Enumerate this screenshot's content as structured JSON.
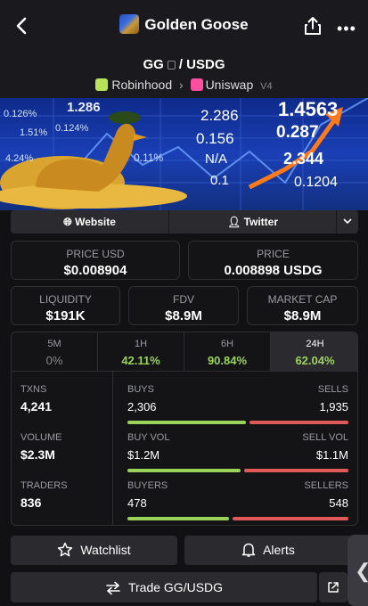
{
  "header": {
    "title": "Golden Goose",
    "back_icon": "chevron-left-icon",
    "share_icon": "share-icon",
    "more_icon": "more-icon"
  },
  "pair": {
    "base": "GG",
    "quote": "USDG",
    "separator": "/",
    "chain": "Robinhood",
    "dex": "Uniswap",
    "version": "V4"
  },
  "banner": {
    "tiles": [
      "1.286",
      "2.286",
      "0.156",
      "N/A",
      "0.1",
      "1.4563",
      "0.287",
      "2.344",
      "0.1204",
      "0.126%",
      "1.51%",
      "0.11%",
      "4.24%",
      "0.124%"
    ]
  },
  "links": {
    "website": "Website",
    "twitter": "Twitter"
  },
  "price": {
    "usd_label": "PRICE USD",
    "usd_value": "$0.008904",
    "native_label": "PRICE",
    "native_value": "0.008898 USDG"
  },
  "metrics": {
    "liquidity_label": "LIQUIDITY",
    "liquidity": "$191K",
    "fdv_label": "FDV",
    "fdv": "$8.9M",
    "mcap_label": "MARKET CAP",
    "mcap": "$8.9M"
  },
  "timeframes": [
    {
      "label": "5M",
      "value": "0%"
    },
    {
      "label": "1H",
      "value": "42.11%"
    },
    {
      "label": "6H",
      "value": "90.84%"
    },
    {
      "label": "24H",
      "value": "62.04%"
    }
  ],
  "stats": {
    "txns_label": "TXNS",
    "txns": "4,241",
    "volume_label": "VOLUME",
    "volume": "$2.3M",
    "traders_label": "TRADERS",
    "traders": "836",
    "buys_label": "BUYS",
    "buys": "2,306",
    "sells_label": "SELLS",
    "sells": "1,935",
    "buys_share": 0.544,
    "buyvol_label": "BUY VOL",
    "buyvol": "$1.2M",
    "sellvol_label": "SELL VOL",
    "sellvol": "$1.1M",
    "buyvol_share": 0.52,
    "buyers_label": "BUYERS",
    "buyers": "478",
    "sellers_label": "SELLERS",
    "sellers": "548",
    "buyers_share": 0.466
  },
  "actions": {
    "watchlist": "Watchlist",
    "alerts": "Alerts",
    "trade": "Trade GG/USDG"
  },
  "colors": {
    "green": "#9bd35a",
    "red": "#e05a5a",
    "bg": "#111114",
    "card": "#141417"
  }
}
